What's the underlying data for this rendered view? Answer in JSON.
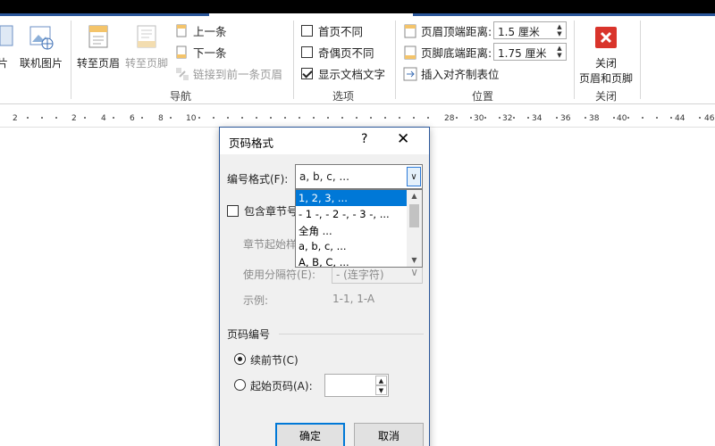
{
  "ribbon": {
    "left_partial_label": "片",
    "online_pictures": "联机图片",
    "goto_header": "转至页眉",
    "goto_footer": "转至页脚",
    "previous": "上一条",
    "next": "下一条",
    "link_previous": "链接到前一条页眉",
    "navigation_group": "导航",
    "different_first_page": "首页不同",
    "different_odd_even": "奇偶页不同",
    "show_document_text": "显示文档文字",
    "options_group": "选项",
    "header_from_top": "页眉顶端距离:",
    "header_from_top_value": "1.5 厘米",
    "footer_from_bottom": "页脚底端距离:",
    "footer_from_bottom_value": "1.75 厘米",
    "insert_alignment_tab": "插入对齐制表位",
    "position_group": "位置",
    "close_header_footer_line1": "关闭",
    "close_header_footer_line2": "页眉和页脚",
    "close_group": "关闭",
    "checkbox_states": {
      "different_first_page": false,
      "different_odd_even": false,
      "show_document_text": true
    }
  },
  "ruler": {
    "ticks": [
      "2",
      "2",
      "4",
      "6",
      "8",
      "10",
      "28",
      "30",
      "32",
      "34",
      "36",
      "38",
      "40",
      "44",
      "46"
    ]
  },
  "dialog": {
    "title": "页码格式",
    "help": "?",
    "close": "✕",
    "number_format_label": "编号格式(F):",
    "number_format_value": "a, b, c, ...",
    "options": [
      "1, 2, 3, ...",
      "- 1 -, - 2 -, - 3 -, ...",
      "全角 ...",
      "a, b, c, ...",
      "A, B, C, ..."
    ],
    "selected_option_index": 0,
    "include_chapter_label": "包含章节号",
    "chapter_starts_label": "章节起始样",
    "use_separator_label": "使用分隔符(E):",
    "separator_value": "- (连字符)",
    "example_label": "示例:",
    "example_value": "1-1, 1-A",
    "page_numbering_label": "页码编号",
    "continue_label": "续前节(C)",
    "start_at_label": "起始页码(A):",
    "start_at_value": "",
    "ok": "确定",
    "cancel": "取消"
  }
}
